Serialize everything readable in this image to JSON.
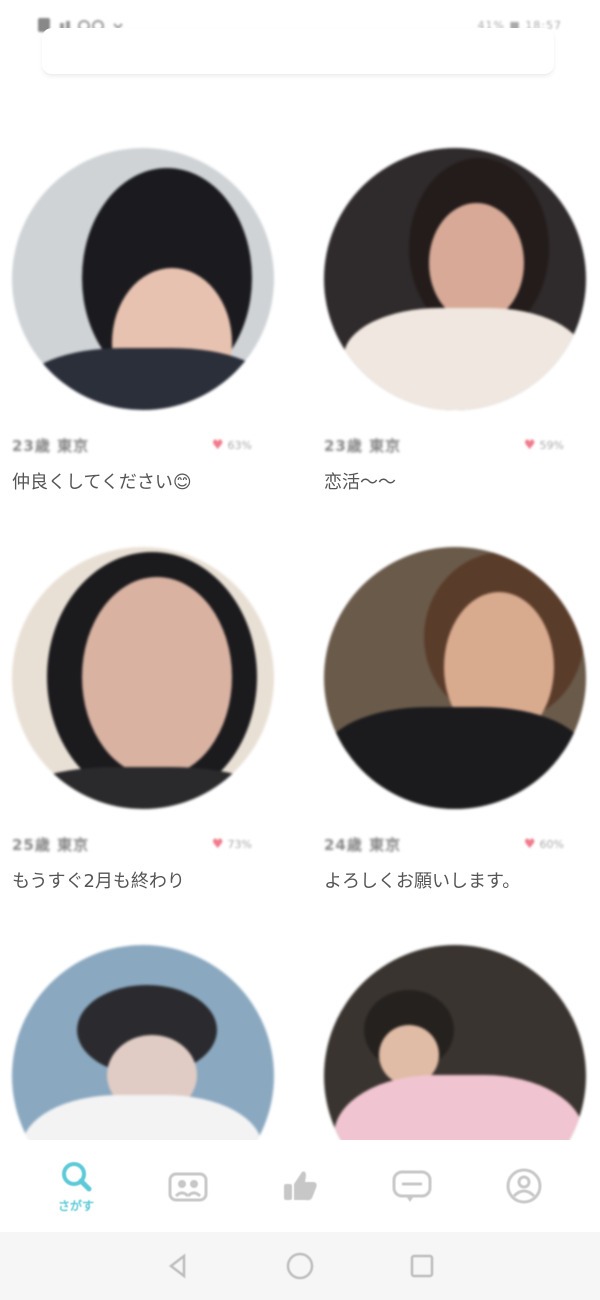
{
  "status_bar": {
    "right_text": "41% ■ 18:57"
  },
  "users": [
    {
      "age_area": "23歳 東京",
      "match_pct": "63%",
      "comment": "仲良くしてください😊",
      "colors": {
        "bg": "#cfd3d6",
        "hair": "#1b1b1f",
        "face": "#e8c2b0",
        "body": "#2b2f3a"
      }
    },
    {
      "age_area": "23歳 東京",
      "match_pct": "59%",
      "comment": "恋活〜〜",
      "colors": {
        "bg": "#2f2a2b",
        "hair": "#231c1b",
        "face": "#d7a996",
        "body": "#f0e7e0"
      }
    },
    {
      "age_area": "25歳 東京",
      "match_pct": "73%",
      "comment": "もうすぐ2月も終わり",
      "colors": {
        "bg": "#e9e0d5",
        "hair": "#1b1a1d",
        "face": "#d9b2a1",
        "body": "#2a2a2d"
      }
    },
    {
      "age_area": "24歳 東京",
      "match_pct": "60%",
      "comment": "よろしくお願いします。",
      "colors": {
        "bg": "#6a5a4a",
        "hair": "#5a3c2a",
        "face": "#d8aa8e",
        "body": "#1b1b1e"
      }
    },
    {
      "age_area": "",
      "match_pct": "",
      "comment": "",
      "colors": {
        "bg": "#8aa8c0",
        "hair": "#2b2b2f",
        "face": "#e0ccc4",
        "body": "#f3f3f4"
      }
    },
    {
      "age_area": "",
      "match_pct": "",
      "comment": "",
      "colors": {
        "bg": "#3a3430",
        "hair": "#25211e",
        "face": "#e0bba5",
        "body": "#f0c4d0"
      }
    }
  ],
  "bottom_nav": {
    "search_label": "さがす",
    "accent": "#5dcad7",
    "inactive": "#c7c7c7"
  }
}
